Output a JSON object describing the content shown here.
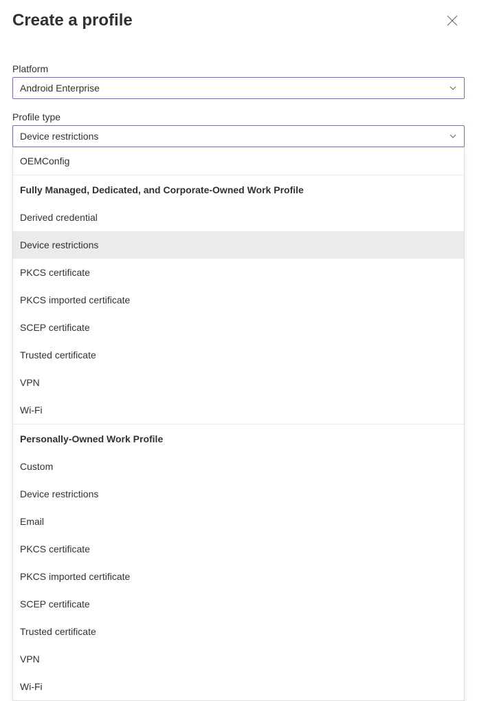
{
  "header": {
    "title": "Create a profile"
  },
  "platform": {
    "label": "Platform",
    "value": "Android Enterprise"
  },
  "profile_type": {
    "label": "Profile type",
    "value": "Device restrictions",
    "options_flat": [
      {
        "type": "item",
        "label": "OEMConfig",
        "selected": false
      },
      {
        "type": "header",
        "label": "Fully Managed, Dedicated, and Corporate-Owned Work Profile"
      },
      {
        "type": "item",
        "label": "Derived credential",
        "selected": false
      },
      {
        "type": "item",
        "label": "Device restrictions",
        "selected": true
      },
      {
        "type": "item",
        "label": "PKCS certificate",
        "selected": false
      },
      {
        "type": "item",
        "label": "PKCS imported certificate",
        "selected": false
      },
      {
        "type": "item",
        "label": "SCEP certificate",
        "selected": false
      },
      {
        "type": "item",
        "label": "Trusted certificate",
        "selected": false
      },
      {
        "type": "item",
        "label": "VPN",
        "selected": false
      },
      {
        "type": "item",
        "label": "Wi-Fi",
        "selected": false
      },
      {
        "type": "header",
        "label": "Personally-Owned Work Profile"
      },
      {
        "type": "item",
        "label": "Custom",
        "selected": false
      },
      {
        "type": "item",
        "label": "Device restrictions",
        "selected": false
      },
      {
        "type": "item",
        "label": "Email",
        "selected": false
      },
      {
        "type": "item",
        "label": "PKCS certificate",
        "selected": false
      },
      {
        "type": "item",
        "label": "PKCS imported certificate",
        "selected": false
      },
      {
        "type": "item",
        "label": "SCEP certificate",
        "selected": false
      },
      {
        "type": "item",
        "label": "Trusted certificate",
        "selected": false
      },
      {
        "type": "item",
        "label": "VPN",
        "selected": false
      },
      {
        "type": "item",
        "label": "Wi-Fi",
        "selected": false
      }
    ]
  }
}
